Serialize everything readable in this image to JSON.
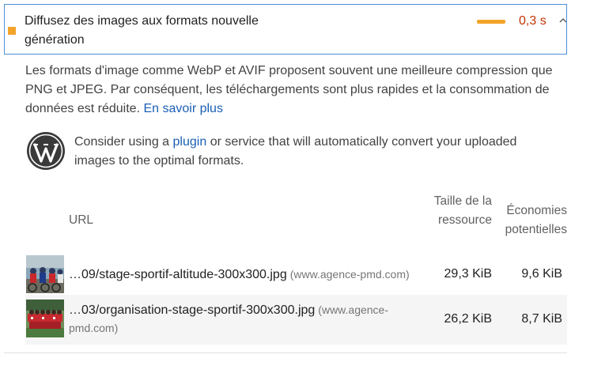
{
  "audit": {
    "title": "Diffusez des images aux formats nouvelle génération",
    "metric": "0,3 s",
    "status_color": "#f4a32a",
    "metric_color": "#c33300",
    "description": "Les formats d'image comme WebP et AVIF proposent souvent une meilleure compression que PNG et JPEG. Par conséquent, les téléchargements sont plus rapides et la consommation de données est réduite.",
    "learn_more": "En savoir plus"
  },
  "stack_pack": {
    "icon": "wordpress-icon",
    "text_before": "Consider using a",
    "link": "plugin",
    "text_after": "or service that will automatically convert your uploaded images to the optimal formats."
  },
  "table": {
    "headers": {
      "url": "URL",
      "size": "Taille de la ressource",
      "savings": "Économies potentielles"
    },
    "rows": [
      {
        "url": "…09/stage-sportif-altitude-300x300.jpg",
        "origin": "(www.agence-pmd.com)",
        "size": "29,3 KiB",
        "savings": "9,6 KiB"
      },
      {
        "url": "…03/organisation-stage-sportif-300x300.jpg",
        "origin": "(www.agence-pmd.com)",
        "size": "26,2 KiB",
        "savings": "8,7 KiB"
      }
    ]
  }
}
